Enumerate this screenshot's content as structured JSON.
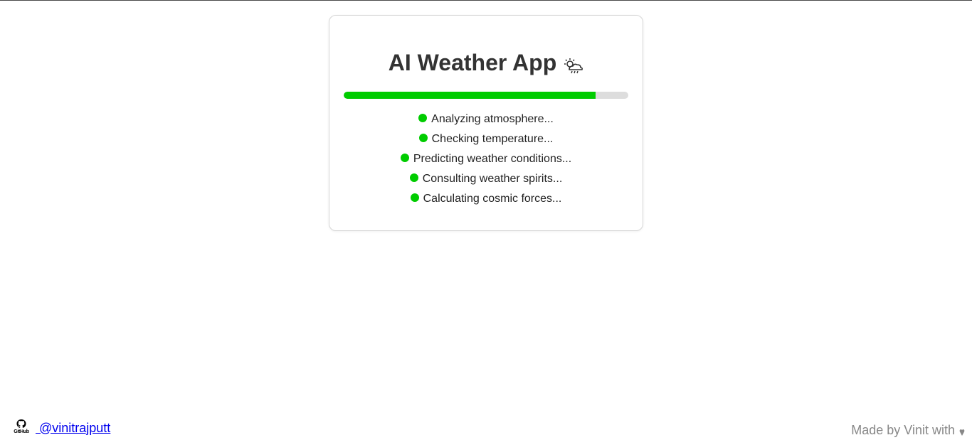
{
  "app": {
    "title": "AI Weather App",
    "title_icon": "cloud-rain-sun-icon"
  },
  "progress": {
    "percent": 88.5,
    "fill_color": "#00cc00",
    "track_color": "#dddddd"
  },
  "steps": [
    {
      "label": "Analyzing atmosphere..."
    },
    {
      "label": "Checking temperature..."
    },
    {
      "label": "Predicting weather conditions..."
    },
    {
      "label": "Consulting weather spirits..."
    },
    {
      "label": "Calculating cosmic forces..."
    }
  ],
  "footer": {
    "github_icon": "github-icon",
    "github_icon_text": "GitHub",
    "github_handle": " @vinitrajputt",
    "credit": "Made by Vinit with",
    "credit_icon": "heart-icon"
  }
}
